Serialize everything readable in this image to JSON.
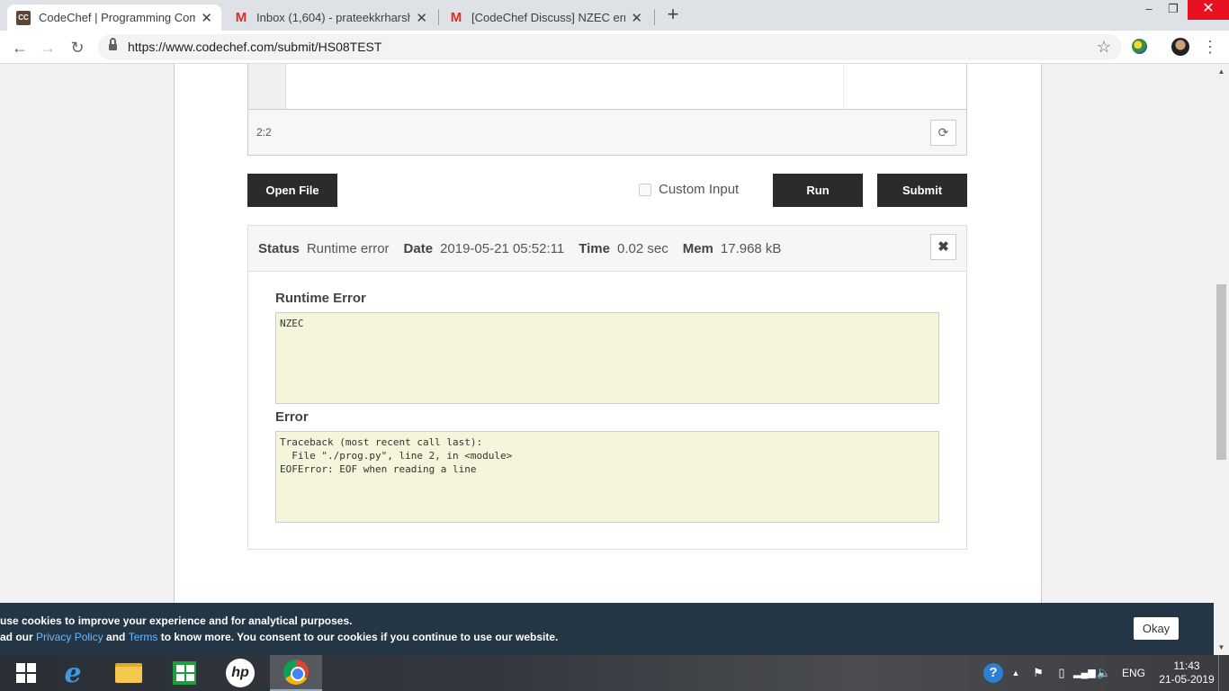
{
  "browser": {
    "tabs": [
      {
        "title": "CodeChef | Programming Compe",
        "favicon": "codechef-icon",
        "active": true
      },
      {
        "title": "Inbox (1,604) - prateekkrharsh@g",
        "favicon": "gmail-icon",
        "active": false
      },
      {
        "title": "[CodeChef Discuss] NZEC error -",
        "favicon": "gmail-icon",
        "active": false
      }
    ],
    "new_tab_label": "+",
    "url": "https://www.codechef.com/submit/HS08TEST",
    "window_controls": {
      "minimize": "–",
      "restore": "❐",
      "close": "✕"
    }
  },
  "editor": {
    "cursor_position": "2:2"
  },
  "actions": {
    "open_file": "Open File",
    "custom_input": "Custom Input",
    "run": "Run",
    "submit": "Submit"
  },
  "result": {
    "status_label": "Status",
    "status_value": "Runtime error",
    "date_label": "Date",
    "date_value": "2019-05-21 05:52:11",
    "time_label": "Time",
    "time_value": "0.02 sec",
    "mem_label": "Mem",
    "mem_value": "17.968 kB",
    "close": "✖",
    "runtime_error_title": "Runtime Error",
    "runtime_error_text": "NZEC",
    "error_title": "Error",
    "error_text": "Traceback (most recent call last):\n  File \"./prog.py\", line 2, in <module>\nEOFError: EOF when reading a line"
  },
  "cookie_banner": {
    "line1": "use cookies to improve your experience and for analytical purposes.",
    "line2_prefix": "ad our ",
    "privacy_link": "Privacy Policy",
    "and_text": " and ",
    "terms_link": "Terms",
    "line2_suffix": " to know more. You consent to our cookies if you continue to use our website.",
    "okay": "Okay"
  },
  "taskbar": {
    "language": "ENG",
    "time": "11:43",
    "date": "21-05-2019",
    "hp_label": "hp"
  },
  "colors": {
    "dark_button": "#2b2b2b",
    "output_background": "#f5f5dc",
    "cookie_background": "#243646",
    "link": "#6ab7ff"
  }
}
